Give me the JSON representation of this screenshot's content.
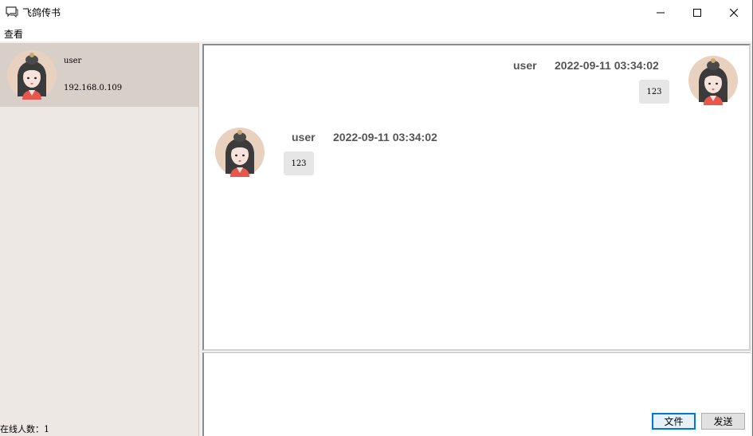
{
  "window": {
    "title": "飞鸽传书",
    "icon": "chat-bubble-icon"
  },
  "menu": {
    "view_label": "查看"
  },
  "contacts": [
    {
      "name": "user",
      "ip": "192.168.0.109"
    }
  ],
  "status": {
    "online_count_label": "在线人数：1"
  },
  "messages": [
    {
      "side": "right",
      "name": "user",
      "time": "2022-09-11 03:34:02",
      "text": "123"
    },
    {
      "side": "left",
      "name": "user",
      "time": "2022-09-11 03:34:02",
      "text": "123"
    }
  ],
  "actions": {
    "file_label": "文件",
    "send_label": "发送"
  },
  "colors": {
    "contact_selected": "#d8cfc9",
    "left_panel": "#ede8e4",
    "bubble": "#e6e6e6",
    "focus_border": "#0078d7"
  }
}
